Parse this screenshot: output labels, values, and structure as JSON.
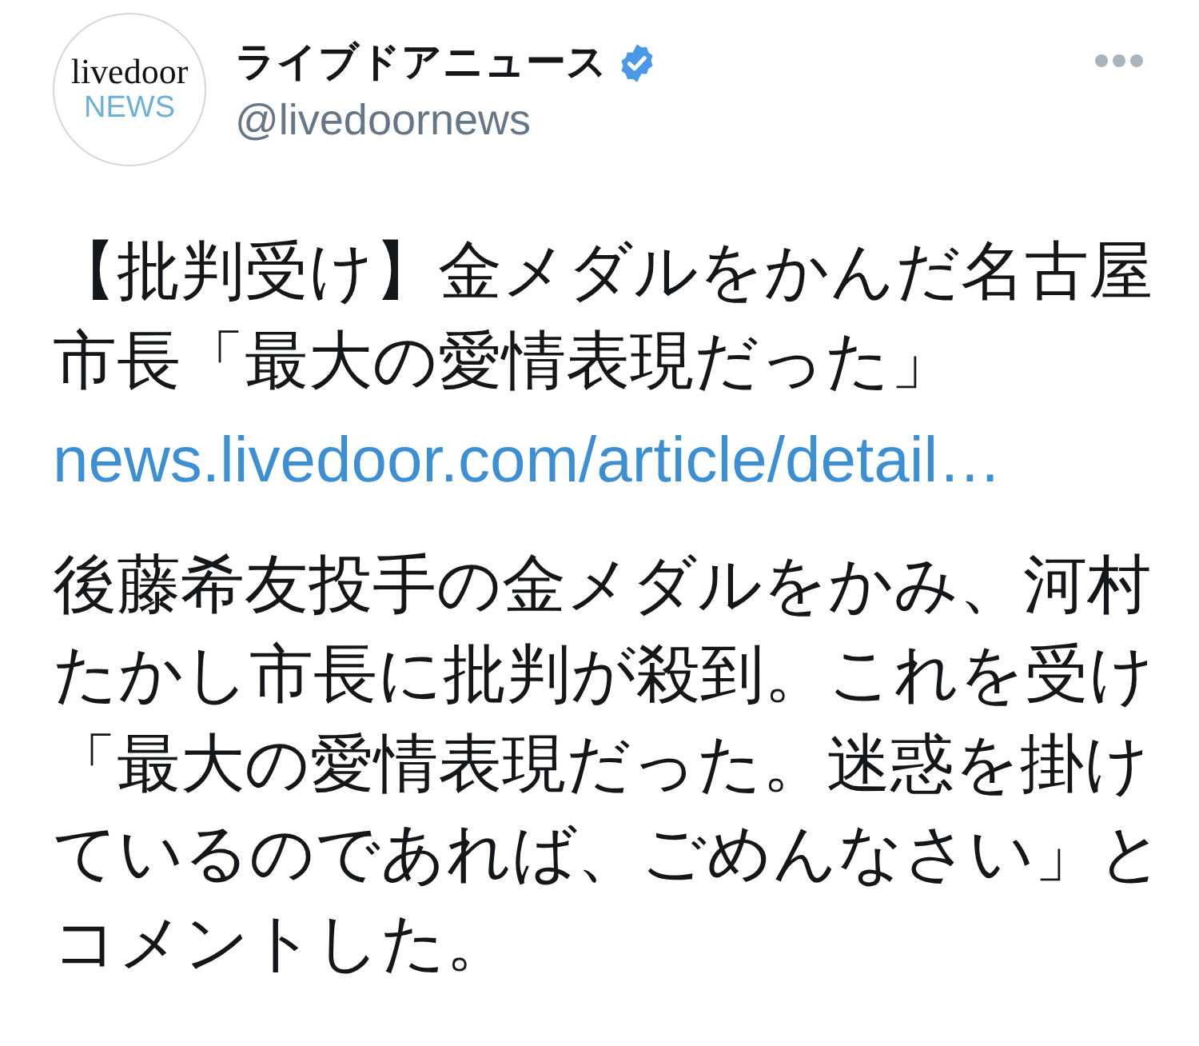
{
  "author": {
    "avatar": {
      "logo_line_1": "livedoor",
      "logo_line_2": "NEWS"
    },
    "display_name": "ライブドアニュース",
    "verified": true,
    "handle": "@livedoornews"
  },
  "tweet": {
    "headline": "【批判受け】金メダルをかんだ名古屋市長「最大の愛情表現だった」",
    "link": "news.livedoor.com/article/detail…",
    "body": "後藤希友投手の金メダルをかみ、河村たかし市長に批判が殺到。これを受け「最大の愛情表現だった。迷惑を掛けているのであれば、ごめんなさい」とコメントした。"
  }
}
